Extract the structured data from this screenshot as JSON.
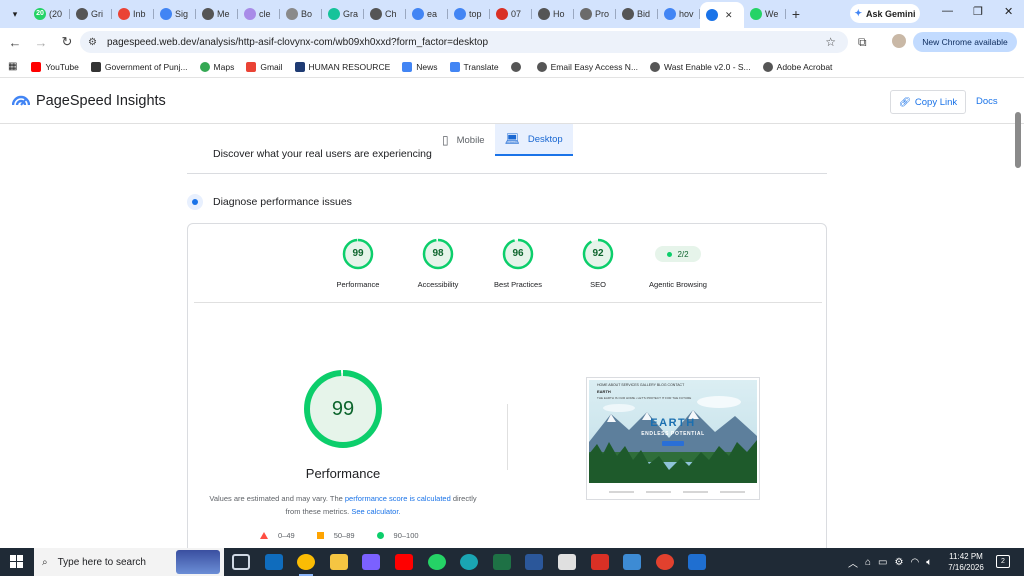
{
  "browser": {
    "tabs": [
      {
        "label": "(20",
        "favicon": "whatsapp-icon",
        "color": "#25d366",
        "badge": "20"
      },
      {
        "label": "Gri",
        "favicon": "chatgpt-icon",
        "color": "#555555"
      },
      {
        "label": "Inb",
        "favicon": "gmail-icon",
        "color": "#ea4335"
      },
      {
        "label": "Sig",
        "favicon": "google-icon",
        "color": "#4285f4"
      },
      {
        "label": "Me",
        "favicon": "chatgpt-icon",
        "color": "#555555"
      },
      {
        "label": "cle",
        "favicon": "gemini-icon",
        "color": "#a88be8"
      },
      {
        "label": "Bo",
        "favicon": "doc-icon",
        "color": "#8a8a8a"
      },
      {
        "label": "Gra",
        "favicon": "grammarly-icon",
        "color": "#15c39a"
      },
      {
        "label": "Ch",
        "favicon": "chatgpt-icon",
        "color": "#555555"
      },
      {
        "label": "ea",
        "favicon": "google-icon",
        "color": "#4285f4"
      },
      {
        "label": "top",
        "favicon": "google-icon",
        "color": "#4285f4"
      },
      {
        "label": "07",
        "favicon": "pdf-icon",
        "color": "#d93025"
      },
      {
        "label": "Ho",
        "favicon": "chatgpt-icon",
        "color": "#555555"
      },
      {
        "label": "Pro",
        "favicon": "globe-icon",
        "color": "#6b6b6b"
      },
      {
        "label": "Bid",
        "favicon": "chatgpt-icon",
        "color": "#555555"
      },
      {
        "label": "hov",
        "favicon": "google-icon",
        "color": "#4285f4"
      },
      {
        "label": "",
        "favicon": "pagespeed-icon",
        "color": "#1a73e8",
        "active": true
      },
      {
        "label": "We",
        "favicon": "whatsapp-icon",
        "color": "#25d366"
      }
    ],
    "new_tab": "+",
    "ask_gemini": "Ask Gemini",
    "url": "pagespeed.web.dev/analysis/http-asif-clovynx-com/wb09xh0xxd?form_factor=desktop",
    "update_button": "New Chrome available",
    "bookmarks": [
      {
        "label": "YouTube",
        "icon": "youtube-icon",
        "color": "#ff0000"
      },
      {
        "label": "Government of Punj...",
        "icon": "wikipedia-icon",
        "color": "#333333"
      },
      {
        "label": "Maps",
        "icon": "maps-icon",
        "color": "#34a853"
      },
      {
        "label": "Gmail",
        "icon": "gmail-icon",
        "color": "#ea4335"
      },
      {
        "label": "HUMAN RESOURCE",
        "icon": "hr-icon",
        "color": "#1f3b73"
      },
      {
        "label": "News",
        "icon": "news-icon",
        "color": "#4285f4"
      },
      {
        "label": "Translate",
        "icon": "translate-icon",
        "color": "#4285f4"
      },
      {
        "label": "",
        "icon": "globe-icon",
        "color": "#555555"
      },
      {
        "label": "Email Easy Access N...",
        "icon": "globe-icon",
        "color": "#555555"
      },
      {
        "label": "Wast Enable v2.0 - S...",
        "icon": "globe-icon",
        "color": "#555555"
      },
      {
        "label": "Adobe Acrobat",
        "icon": "globe-icon",
        "color": "#555555"
      }
    ]
  },
  "header": {
    "title": "PageSpeed Insights",
    "copy_link": "Copy Link",
    "docs": "Docs"
  },
  "view_tabs": {
    "mobile": "Mobile",
    "desktop": "Desktop"
  },
  "faded_text": "Discover what your real users are experiencing",
  "diagnose": {
    "title": "Diagnose performance issues",
    "scores": [
      {
        "label": "Performance",
        "value": "99",
        "fraction": 0.99
      },
      {
        "label": "Accessibility",
        "value": "98",
        "fraction": 0.98
      },
      {
        "label": "Best Practices",
        "value": "96",
        "fraction": 0.96
      },
      {
        "label": "SEO",
        "value": "92",
        "fraction": 0.92
      }
    ],
    "agentic": {
      "label": "Agentic Browsing",
      "value": "2/2"
    },
    "big_score": {
      "value": "99",
      "label": "Performance",
      "fraction": 0.99
    },
    "note_part1": "Values are estimated and may vary. The ",
    "note_link1": "performance score is calculated",
    "note_part2": " directly from these metrics. ",
    "note_link2": "See calculator.",
    "legend": [
      {
        "range": "0–49",
        "shape": "triangle",
        "color": "#ff4e42"
      },
      {
        "range": "50–89",
        "shape": "square",
        "color": "#ffa400"
      },
      {
        "range": "90–100",
        "shape": "circle",
        "color": "#0cce6b"
      }
    ]
  },
  "screenshot": {
    "nav": "HOME   ABOUT   SERVICES   GALLERY   BLOG   CONTACT",
    "logo": "EARTH",
    "tagline": "THE EARTH IS OUR HOME • LET'S PROTECT IT FOR THE FUTURE",
    "headline": "EARTH",
    "subheadline": "ENDLESS POTENTIAL"
  },
  "taskbar": {
    "search_placeholder": "Type here to search",
    "time": "11:42 PM",
    "date": "7/16/2026",
    "notifications": "2"
  }
}
